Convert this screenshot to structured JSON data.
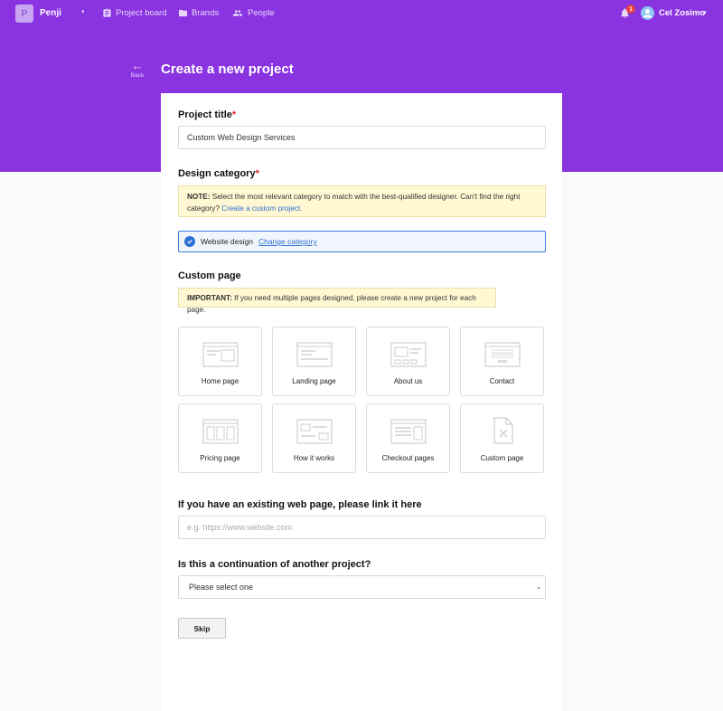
{
  "header": {
    "brand_initial": "P",
    "brand_name": "Penji",
    "nav": [
      {
        "label": "Project board",
        "icon": "clipboard-icon"
      },
      {
        "label": "Brands",
        "icon": "folder-icon"
      },
      {
        "label": "People",
        "icon": "people-icon"
      }
    ],
    "notification_count": "1",
    "user_name": "Cel Zosimo"
  },
  "page": {
    "back_label": "Back",
    "title": "Create a new project"
  },
  "form": {
    "project_title": {
      "label": "Project title",
      "required_mark": "*",
      "value": "Custom Web Design Services"
    },
    "design_category": {
      "label": "Design category",
      "required_mark": "*",
      "note_prefix": "NOTE:",
      "note_text": " Select the most relevant category to match with the best-qualified designer. Can't find the right category? ",
      "note_link": "Create a custom project.",
      "selected_value": "Website design",
      "change_link": "Change category"
    },
    "custom_page": {
      "label": "Custom page",
      "important_prefix": "IMPORTANT:",
      "important_text": " If you need multiple pages designed, please create a new project for each page.",
      "tiles": [
        {
          "label": "Home page"
        },
        {
          "label": "Landing page"
        },
        {
          "label": "About us"
        },
        {
          "label": "Contact"
        },
        {
          "label": "Pricing page"
        },
        {
          "label": "How it works"
        },
        {
          "label": "Checkout pages"
        },
        {
          "label": "Custom page"
        }
      ]
    },
    "existing_page": {
      "label": "If you have an existing web page, please link it here",
      "placeholder": "e.g. https://www.website.com"
    },
    "continuation": {
      "label": "Is this a continuation of another project?",
      "selected": "Please select one"
    },
    "skip_label": "Skip"
  },
  "colors": {
    "header_purple": "#8a33e0",
    "link_blue": "#2f6fd6",
    "required_red": "#d9262c",
    "note_yellow": "#fff8d3"
  }
}
